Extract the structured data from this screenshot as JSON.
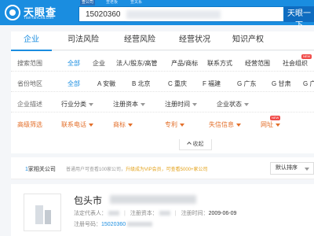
{
  "header": {
    "logo_text": "天眼查",
    "logo_sub": "TianYanCha.com",
    "search_tabs": [
      "查公司",
      "查老板",
      "查关系"
    ],
    "search_value": "15020360",
    "search_button": "天眼一下"
  },
  "nav": {
    "tabs": [
      "企业",
      "司法风险",
      "经营风险",
      "经营状况",
      "知识产权"
    ]
  },
  "filters": {
    "search_range": {
      "label": "搜索范围",
      "options": [
        "全部",
        "企业",
        "法人/股东/高管",
        "产品/商标",
        "联系方式",
        "经营范围",
        "社会组织"
      ],
      "new_badge": "NEW"
    },
    "region": {
      "label": "省份地区",
      "options": [
        "全部",
        "A 安徽",
        "B 北京",
        "C 重庆",
        "F 福建",
        "G 广东",
        "G 甘肃",
        "G 广西"
      ]
    },
    "company_desc": {
      "label": "企业描述",
      "dropdowns": [
        "行业分类",
        "注册资本",
        "注册时间",
        "企业状态"
      ]
    },
    "advanced": {
      "label": "高级筛选",
      "dropdowns": [
        "联系电话",
        "商标",
        "专利",
        "失信信息",
        "网址"
      ],
      "new_badge": "NEW"
    },
    "collapse_label": "收起"
  },
  "results": {
    "count": "1",
    "count_suffix": "家相关公司",
    "note": "普通用户可查看100家公司，",
    "note_link": "升级成为VIP会员，可查看5000+家公司",
    "sort_label": "默认排序"
  },
  "company": {
    "name_prefix": "包头市",
    "legal_rep_label": "法定代表人：",
    "reg_capital_label": "注册资本：",
    "reg_time_label": "注册时间：",
    "reg_time": "2009-06-09",
    "reg_no_label": "注册号码：",
    "reg_no": "15020360"
  },
  "colors": {
    "brand_blue": "#1a8de0",
    "orange": "#e36f2a",
    "new_badge": "#f04a48"
  }
}
